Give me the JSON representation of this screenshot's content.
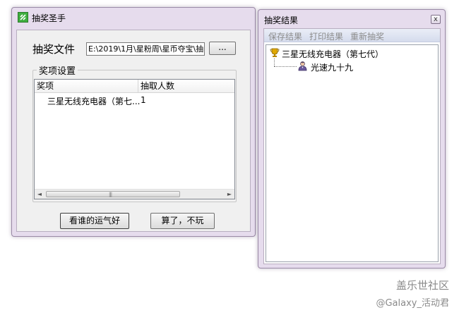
{
  "main_window": {
    "title": "抽奖圣手",
    "file_label": "抽奖文件",
    "file_path": "E:\\2019\\1月\\星粉周\\星币夺宝\\抽",
    "browse_label": "...",
    "prize_group_title": "奖项设置",
    "columns": [
      "奖项",
      "抽取人数"
    ],
    "rows": [
      {
        "prize": "三星无线充电器（第七...",
        "count": "1"
      }
    ],
    "scroll_left": "◄",
    "scroll_right": "►",
    "scroll_grip": "|||",
    "draw_button": "看谁的运气好",
    "quit_button": "算了，不玩"
  },
  "result_window": {
    "title": "抽奖结果",
    "close_label": "x",
    "menu": [
      "保存结果",
      "打印结果",
      "重新抽奖"
    ],
    "prize_node": "三星无线充电器（第七代）",
    "winner_node": "光速九十九"
  },
  "watermark": {
    "line1": "盖乐世社区",
    "line2": "@Galaxy_活动君"
  },
  "colors": {
    "frame": "#e6dced",
    "client": "#f0f0f0",
    "menubar": "#d5dced",
    "menu_text_disabled": "#8c8c8c",
    "icon_green": "#3fae3f",
    "trophy_gold": "#e0a800"
  },
  "icons": {
    "app": "lottery-app-icon",
    "prize": "trophy-icon",
    "winner": "user-icon",
    "close": "close-icon"
  }
}
